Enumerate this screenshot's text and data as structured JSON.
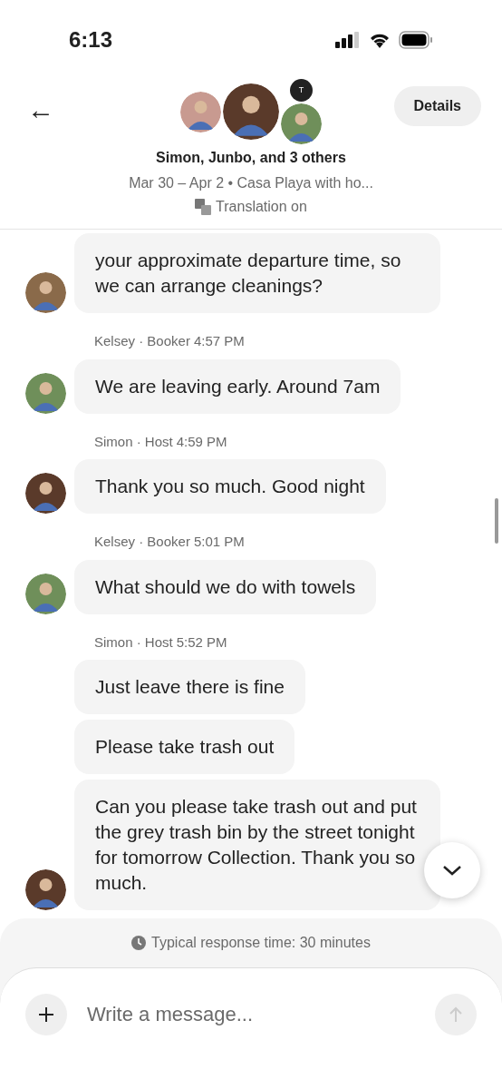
{
  "status_bar": {
    "time": "6:13"
  },
  "header": {
    "back": "←",
    "avatar_initial": "T",
    "title": "Simon, Junbo, and 3 others",
    "subtitle": "Mar 30 – Apr 2 • Casa Playa with ho...",
    "translation": "Translation on",
    "details_button": "Details"
  },
  "groups": [
    {
      "messages": [
        "your approximate departure time, so we can arrange cleanings?"
      ]
    },
    {
      "meta": "Kelsey · Booker",
      "time": "4:57 PM",
      "messages": [
        "We are leaving early. Around 7am"
      ]
    },
    {
      "meta": "Simon · Host",
      "time": "4:59 PM",
      "messages": [
        "Thank you so much. Good night"
      ]
    },
    {
      "meta": "Kelsey · Booker",
      "time": "5:01 PM",
      "messages": [
        "What should we do with towels"
      ]
    },
    {
      "meta": "Simon · Host",
      "time": "5:52 PM",
      "messages": [
        "Just leave there is fine",
        "Please take trash out",
        "Can you please take trash out and put the grey trash bin by the street tonight  for tomorrow Collection. Thank you so much."
      ]
    }
  ],
  "response_time": "Typical response time: 30 minutes",
  "composer": {
    "placeholder": "Write a message..."
  }
}
